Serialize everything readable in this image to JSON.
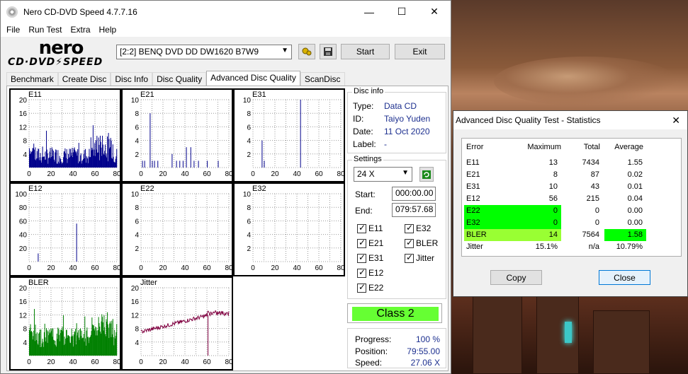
{
  "window": {
    "title": "Nero CD-DVD Speed 4.7.7.16",
    "minimize": "—",
    "maximize": "☐",
    "close": "✕"
  },
  "menu": [
    "File",
    "Run Test",
    "Extra",
    "Help"
  ],
  "logo": {
    "line1": "nero",
    "line2": "CD·DVD⚡SPEED"
  },
  "drive": {
    "value": "[2:2]   BENQ DVD DD DW1620 B7W9"
  },
  "buttons": {
    "start": "Start",
    "exit": "Exit"
  },
  "tabs": [
    "Benchmark",
    "Create Disc",
    "Disc Info",
    "Disc Quality",
    "Advanced Disc Quality",
    "ScanDisc"
  ],
  "active_tab": "Advanced Disc Quality",
  "disc_info": {
    "title": "Disc info",
    "type_label": "Type:",
    "type": "Data CD",
    "id_label": "ID:",
    "id": "Taiyo Yuden",
    "date_label": "Date:",
    "date": "11 Oct 2020",
    "label_label": "Label:",
    "label": "-"
  },
  "settings": {
    "title": "Settings",
    "speed": "24 X",
    "start_label": "Start:",
    "start": "000:00.00",
    "end_label": "End:",
    "end": "079:57.68",
    "checks": [
      "E11",
      "E32",
      "E21",
      "BLER",
      "E31",
      "Jitter",
      "E12",
      "E22"
    ]
  },
  "class": "Class 2",
  "progress": {
    "progress_label": "Progress:",
    "progress": "100 %",
    "position_label": "Position:",
    "position": "79:55.00",
    "speed_label": "Speed:",
    "speed": "27.06 X"
  },
  "chart_data": [
    {
      "type": "bar",
      "title": "E11",
      "ylim": [
        0,
        20
      ],
      "yticks": [
        "20",
        "16",
        "12",
        "8",
        "4"
      ],
      "xticks": [
        "0",
        "20",
        "40",
        "60",
        "80"
      ],
      "color": "#00008b"
    },
    {
      "type": "bar",
      "title": "E21",
      "ylim": [
        0,
        10
      ],
      "yticks": [
        "10",
        "8",
        "6",
        "4",
        "2"
      ],
      "xticks": [
        "0",
        "20",
        "40",
        "60",
        "80"
      ],
      "color": "#00008b"
    },
    {
      "type": "bar",
      "title": "E31",
      "ylim": [
        0,
        10
      ],
      "yticks": [
        "10",
        "8",
        "6",
        "4",
        "2"
      ],
      "xticks": [
        "0",
        "20",
        "40",
        "60",
        "80"
      ],
      "color": "#00008b"
    },
    {
      "type": "bar",
      "title": "E12",
      "ylim": [
        0,
        100
      ],
      "yticks": [
        "100",
        "80",
        "60",
        "40",
        "20"
      ],
      "xticks": [
        "0",
        "20",
        "40",
        "60",
        "80"
      ],
      "color": "#00008b"
    },
    {
      "type": "bar",
      "title": "E22",
      "ylim": [
        0,
        10
      ],
      "yticks": [
        "10",
        "8",
        "6",
        "4",
        "2"
      ],
      "xticks": [
        "0",
        "20",
        "40",
        "60",
        "80"
      ],
      "color": "#00008b"
    },
    {
      "type": "bar",
      "title": "E32",
      "ylim": [
        0,
        10
      ],
      "yticks": [
        "10",
        "8",
        "6",
        "4",
        "2"
      ],
      "xticks": [
        "0",
        "20",
        "40",
        "60",
        "80"
      ],
      "color": "#00008b"
    },
    {
      "type": "bar",
      "title": "BLER",
      "ylim": [
        0,
        20
      ],
      "yticks": [
        "20",
        "16",
        "12",
        "8",
        "4"
      ],
      "xticks": [
        "0",
        "20",
        "40",
        "60",
        "80"
      ],
      "color": "#008000"
    },
    {
      "type": "line",
      "title": "Jitter",
      "ylim": [
        0,
        20
      ],
      "yticks": [
        "20",
        "16",
        "12",
        "8",
        "4"
      ],
      "xticks": [
        "0",
        "20",
        "40",
        "60",
        "80"
      ],
      "color": "#800040"
    }
  ],
  "stats_dialog": {
    "title": "Advanced Disc Quality Test - Statistics",
    "close_x": "✕",
    "headers": [
      "Error",
      "Maximum",
      "Total",
      "Average"
    ],
    "rows": [
      [
        "E11",
        "13",
        "7434",
        "1.55"
      ],
      [
        "E21",
        "8",
        "87",
        "0.02"
      ],
      [
        "E31",
        "10",
        "43",
        "0.01"
      ],
      [
        "E12",
        "56",
        "215",
        "0.04"
      ],
      [
        "E22",
        "0",
        "0",
        "0.00"
      ],
      [
        "E32",
        "0",
        "0",
        "0.00"
      ],
      [
        "BLER",
        "14",
        "7564",
        "1.58"
      ],
      [
        "Jitter",
        "15.1%",
        "n/a",
        "10.79%"
      ]
    ],
    "copy": "Copy",
    "close": "Close",
    "highlight_colors": {
      "green": "#00ff00",
      "lime": "#99ff33"
    }
  }
}
